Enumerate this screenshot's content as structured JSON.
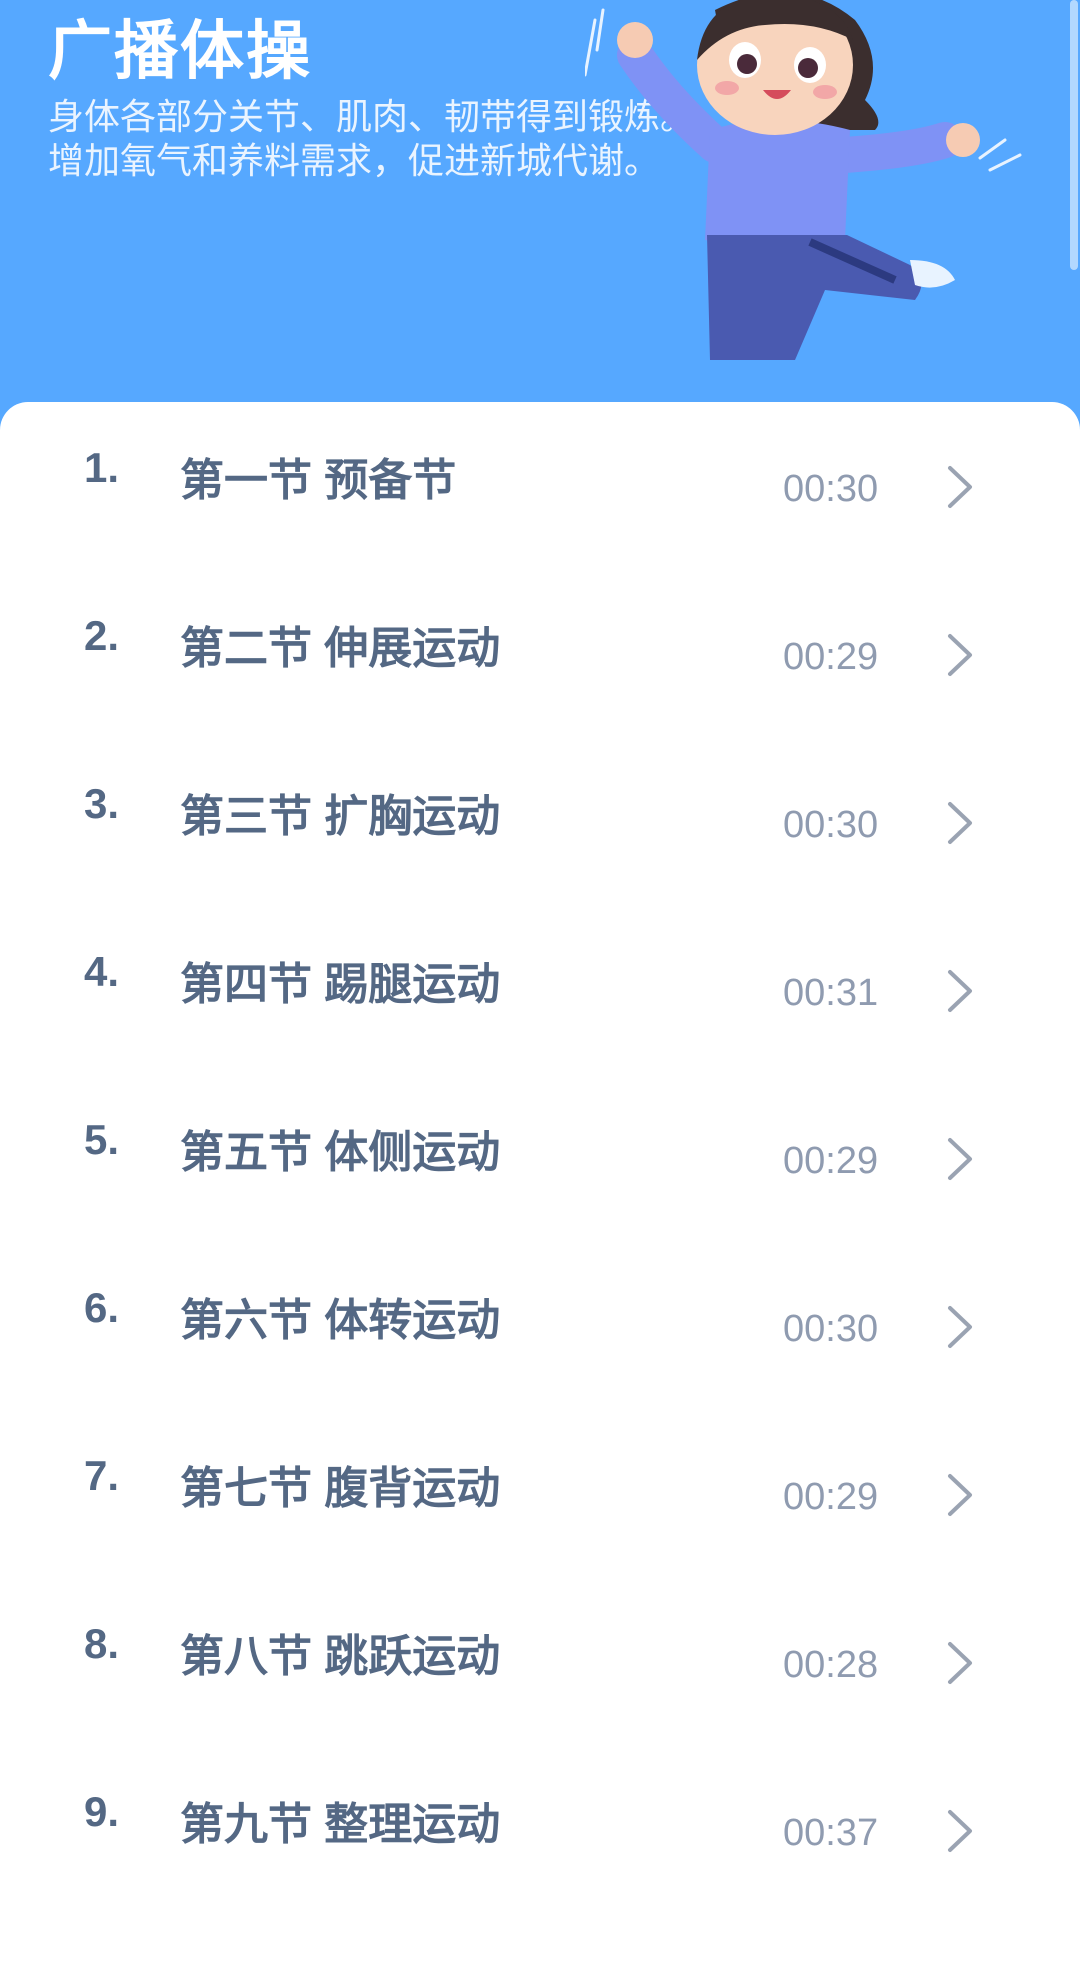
{
  "header": {
    "title": "广播体操",
    "subtitle_line1": "身体各部分关节、肌肉、韧带得到锻炼。",
    "subtitle_line2": "增加氧气和养料需求，促进新城代谢。"
  },
  "colors": {
    "header_bg": "#56a8ff",
    "card_bg": "#ffffff",
    "item_text": "#546884",
    "duration_text": "#8f9bb0",
    "chevron": "#9aa3b2"
  },
  "items": [
    {
      "number": "1.",
      "title": "第一节 预备节",
      "duration": "00:30",
      "icon": "chevron-right-icon"
    },
    {
      "number": "2.",
      "title": "第二节 伸展运动",
      "duration": "00:29",
      "icon": "chevron-right-icon"
    },
    {
      "number": "3.",
      "title": "第三节 扩胸运动",
      "duration": "00:30",
      "icon": "chevron-right-icon"
    },
    {
      "number": "4.",
      "title": "第四节 踢腿运动",
      "duration": "00:31",
      "icon": "chevron-right-icon"
    },
    {
      "number": "5.",
      "title": "第五节 体侧运动",
      "duration": "00:29",
      "icon": "chevron-right-icon"
    },
    {
      "number": "6.",
      "title": "第六节 体转运动",
      "duration": "00:30",
      "icon": "chevron-right-icon"
    },
    {
      "number": "7.",
      "title": "第七节 腹背运动",
      "duration": "00:29",
      "icon": "chevron-right-icon"
    },
    {
      "number": "8.",
      "title": "第八节 跳跃运动",
      "duration": "00:28",
      "icon": "chevron-right-icon"
    },
    {
      "number": "9.",
      "title": "第九节 整理运动",
      "duration": "00:37",
      "icon": "chevron-right-icon"
    }
  ]
}
